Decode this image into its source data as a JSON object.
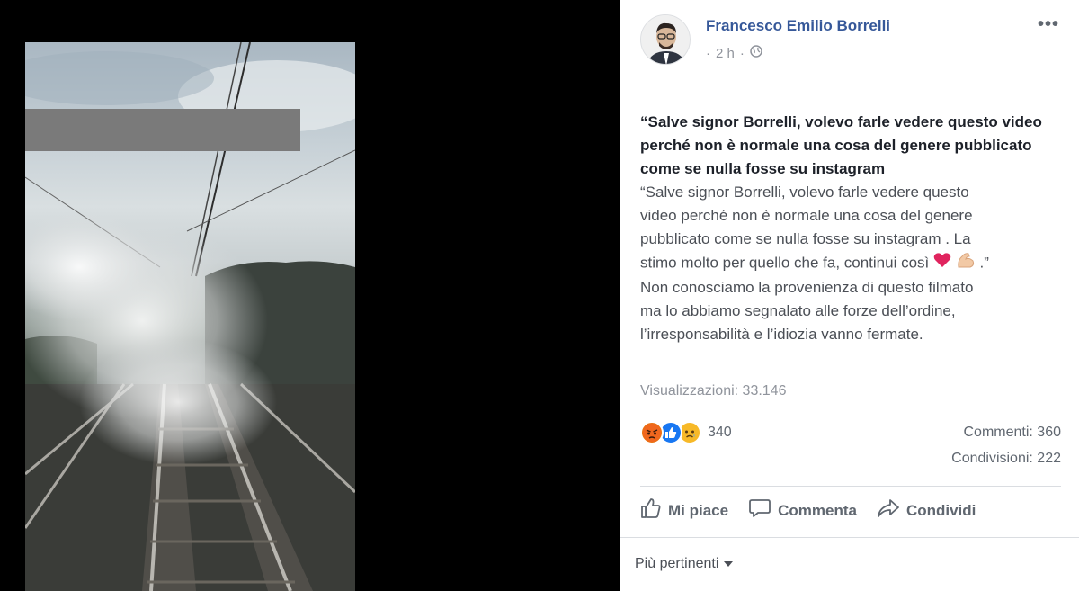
{
  "post": {
    "author": "Francesco Emilio Borrelli",
    "time": "2 h",
    "time_prefix": "·",
    "more_label": "•••",
    "title": "“Salve signor Borrelli, volevo farle vedere questo video perché non è normale una cosa del genere pubblicato come se nulla fosse su instagram",
    "body_lines": [
      "“Salve signor Borrelli, volevo farle vedere questo",
      "video perché non è normale una cosa del genere",
      "pubblicato come se nulla fosse su instagram . La",
      "stimo molto per quello che fa, continui così",
      "Non conosciamo la provenienza di questo filmato",
      "ma lo abbiamo segnalato alle forze dell’ordine,",
      "l’irresponsabilità e l’idiozia vanno fermate."
    ],
    "emoji_suffix": ".”",
    "views": "Visualizzazioni: 33.146"
  },
  "reactions": {
    "count": "340",
    "icons": [
      "angry-icon",
      "like-icon",
      "sad-icon"
    ],
    "colors": {
      "angry": "#e9710f",
      "like": "#1877f2",
      "sad": "#f7b928"
    }
  },
  "stats": {
    "comments": "Commenti: 360",
    "shares": "Condivisioni: 222"
  },
  "actions": {
    "like": "Mi piace",
    "comment": "Commenta",
    "share": "Condividi"
  },
  "sort": {
    "label": "Più pertinenti"
  },
  "colors": {
    "author": "#365899",
    "meta": "#90949c",
    "text": "#1d2129"
  }
}
